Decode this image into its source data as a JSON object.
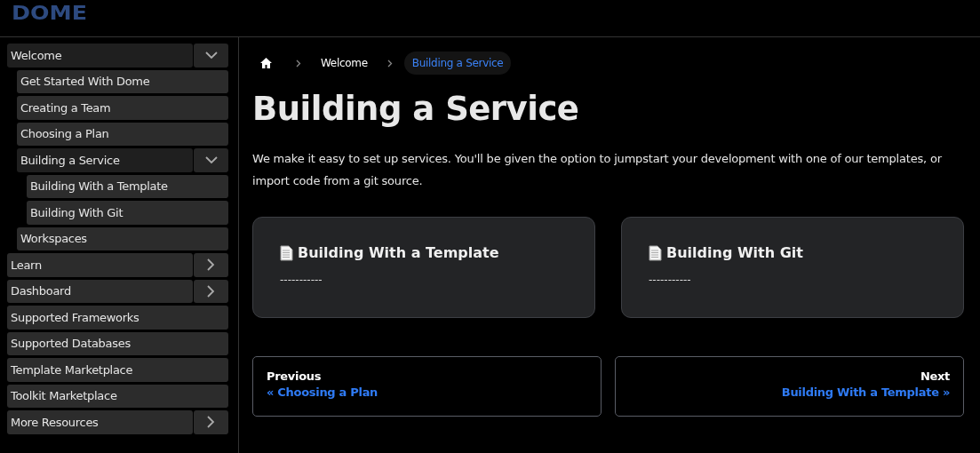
{
  "header": {
    "logo": "DOME"
  },
  "sidebar": {
    "items": [
      {
        "label": "Welcome",
        "expanded": true,
        "children": [
          {
            "label": "Get Started With Dome"
          },
          {
            "label": "Creating a Team"
          },
          {
            "label": "Choosing a Plan"
          },
          {
            "label": "Building a Service",
            "expanded": true,
            "children": [
              {
                "label": "Building With a Template"
              },
              {
                "label": "Building With Git"
              }
            ]
          },
          {
            "label": "Workspaces"
          }
        ]
      },
      {
        "label": "Learn",
        "expanded": false
      },
      {
        "label": "Dashboard",
        "expanded": false
      },
      {
        "label": "Supported Frameworks"
      },
      {
        "label": "Supported Databases"
      },
      {
        "label": "Template Marketplace"
      },
      {
        "label": "Toolkit Marketplace"
      },
      {
        "label": "More Resources",
        "expanded": false
      }
    ]
  },
  "breadcrumbs": [
    {
      "label": "Welcome",
      "selected": false
    },
    {
      "label": "Building a Service",
      "selected": true
    }
  ],
  "title": "Building a Service",
  "intro": "We make it easy to set up services. You'll be given the option to jumpstart your development with one of our templates, or import code from a git source.",
  "cards": [
    {
      "title": "Building With a Template",
      "description": "-----------"
    },
    {
      "title": "Building With Git",
      "description": "-----------"
    }
  ],
  "pagination": {
    "previous": {
      "label": "Previous",
      "link": "« Choosing a Plan"
    },
    "next": {
      "label": "Next",
      "link": "Building With a Template »"
    }
  }
}
